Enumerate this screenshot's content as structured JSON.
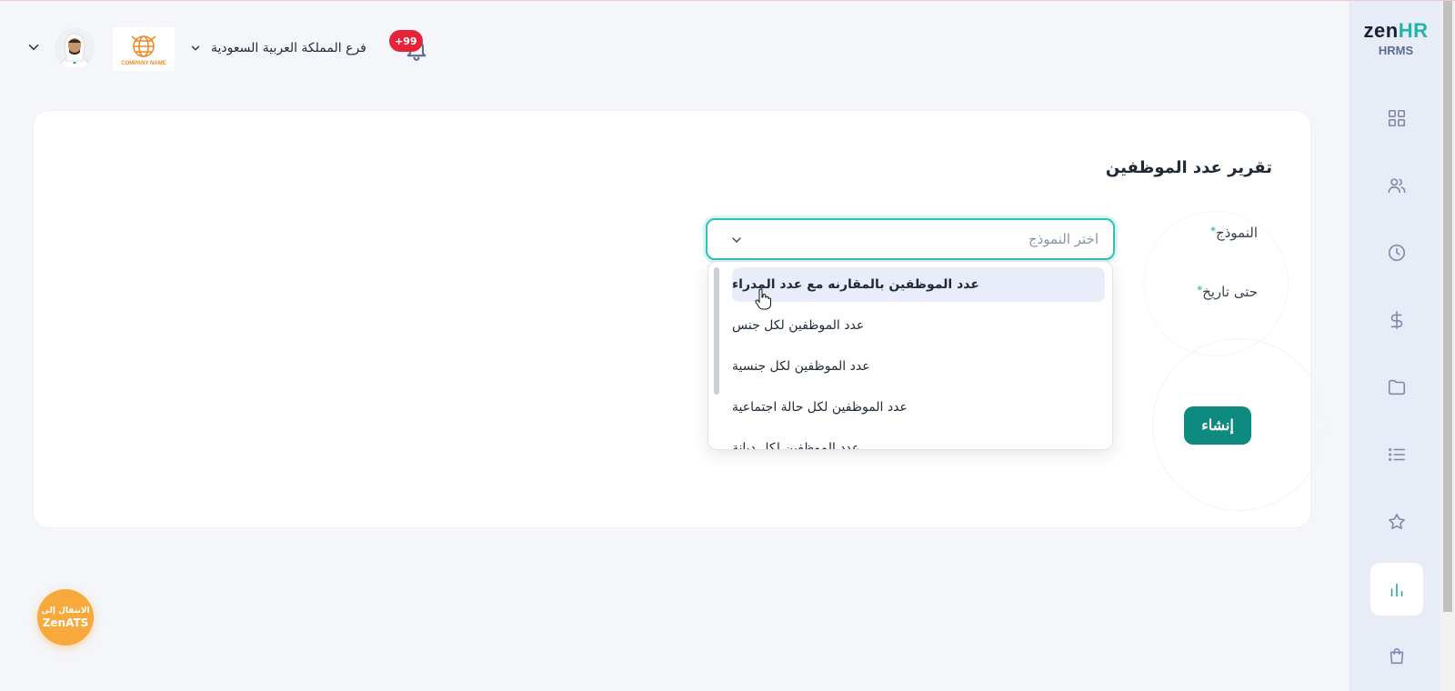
{
  "header": {
    "branch_name": "فرع المملكة العربية السعودية",
    "notification_count": "+99",
    "company_logo_text": "COMPANY NAME"
  },
  "sidebar": {
    "brand_zen": "zen",
    "brand_hr": "HR",
    "brand_sub": "HRMS",
    "items": [
      {
        "icon": "dashboard-grid-icon"
      },
      {
        "icon": "users-icon"
      },
      {
        "icon": "clock-icon"
      },
      {
        "icon": "dollar-icon"
      },
      {
        "icon": "folder-icon"
      },
      {
        "icon": "list-icon"
      },
      {
        "icon": "star-icon"
      },
      {
        "icon": "bar-chart-icon",
        "active": true
      },
      {
        "icon": "shopping-bag-icon"
      }
    ]
  },
  "report": {
    "title": "تقرير عدد الموظفين",
    "template_label": "النموذج",
    "date_label": "حتى تاريخ",
    "required_mark": "*",
    "select_placeholder": "اختر النموذج",
    "options": [
      "عدد الموظفين بالمقارنه مع عدد المدراء",
      "عدد الموظفين لكل جنس",
      "عدد الموظفين لكل جنسية",
      "عدد الموظفين لكل حالة اجتماعية",
      "عدد الموظفين لكل ديانة"
    ],
    "create_button": "إنشاء"
  },
  "ats_button": {
    "line1": "الانتقال إلى",
    "line2": "ZenATS"
  },
  "colors": {
    "accent": "#1aa89b",
    "button": "#0f8a80",
    "badge": "#e5243b",
    "ats": "#f7a93b"
  }
}
